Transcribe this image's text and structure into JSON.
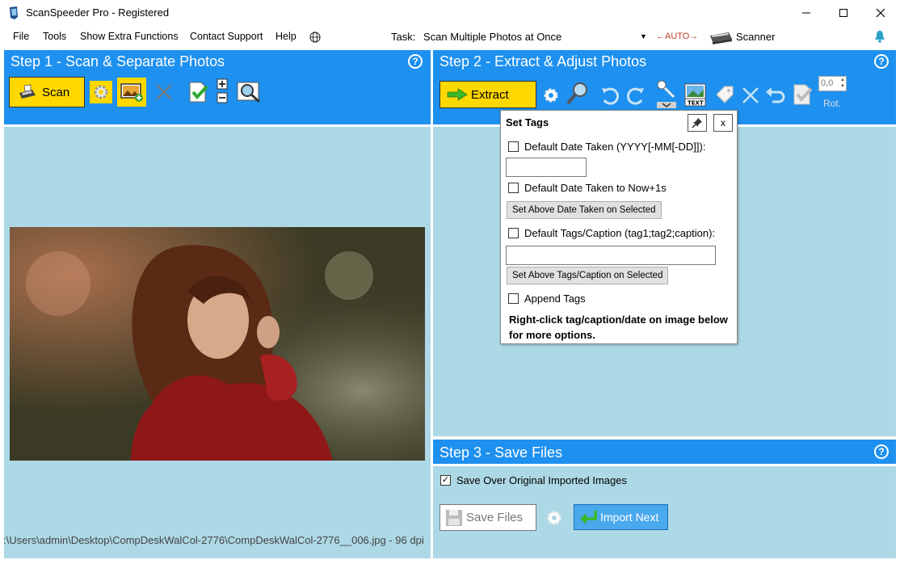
{
  "window": {
    "title": "ScanSpeeder Pro - Registered"
  },
  "menu": {
    "items": [
      "File",
      "Tools",
      "Show Extra Functions",
      "Contact Support",
      "Help"
    ]
  },
  "task": {
    "label": "Task:",
    "value": "Scan Multiple Photos at Once",
    "auto": "←AUTO→",
    "scanner": "Scanner"
  },
  "step1": {
    "title": "Step 1 - Scan & Separate Photos",
    "scan_label": "Scan",
    "status_path": ":\\Users\\admin\\Desktop\\CompDeskWalCol-2776\\CompDeskWalCol-2776__006.jpg - 96 dpi"
  },
  "step2": {
    "title": "Step 2 - Extract & Adjust Photos",
    "extract_label": "Extract",
    "rotation_value": "0,0",
    "rotation_label": "Rot."
  },
  "set_tags": {
    "title": "Set Tags",
    "close": "x",
    "date_taken_label": "Default Date Taken (YYYY[-MM[-DD]]):",
    "date_now_label": "Default Date Taken to Now+1s",
    "set_date_button": "Set Above Date Taken on Selected",
    "tags_caption_label": "Default Tags/Caption (tag1;tag2;caption):",
    "set_tags_button": "Set Above Tags/Caption on Selected",
    "append_tags_label": "Append Tags",
    "note": "Right-click tag/caption/date on image below for more options."
  },
  "step3": {
    "title": "Step 3 - Save Files",
    "save_over_label": "Save Over Original Imported Images",
    "save_files": "Save Files",
    "import_next": "Import Next"
  },
  "help_glyph": "?",
  "colors": {
    "panel_header": "#1e90ef",
    "panel_body": "#add8e6",
    "button_yellow": "#ffd800",
    "import_blue": "#4aa8ec"
  }
}
